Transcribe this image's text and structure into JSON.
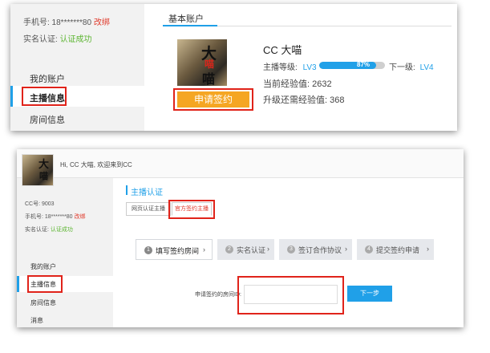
{
  "panel1": {
    "sidebar": {
      "phone_label": "手机号: 18*******80",
      "phone_action": "改绑",
      "verify_label": "实名认证:",
      "verify_status": "认证成功",
      "menu": [
        {
          "label": "我的账户"
        },
        {
          "label": "主播信息",
          "active": true
        },
        {
          "label": "房间信息"
        }
      ]
    },
    "tab_title": "基本账户",
    "avatar_glyphs": [
      "大",
      "喵",
      "喵"
    ],
    "apply_button": "申请签约",
    "name": "CC 大喵",
    "level": {
      "label": "主播等级:",
      "current": "LV3",
      "progress_percent": 87,
      "progress_text": "87%",
      "next_label": "下一级:",
      "next": "LV4"
    },
    "exp_current": "当前经验值: 2632",
    "exp_needed": "升级还需经验值: 368"
  },
  "panel2": {
    "greeting": "Hi, CC 大喵, 欢迎来到CC",
    "avatar_glyphs": [
      "大",
      "喵"
    ],
    "sidebar": {
      "cc_no": "CC号: 9003",
      "phone_label": "手机号: 18*******80",
      "phone_action": "改绑",
      "verify_label": "实名认证:",
      "verify_status": "认证成功",
      "menu": [
        {
          "label": "我的账户"
        },
        {
          "label": "主播信息",
          "active": true
        },
        {
          "label": "房间信息"
        },
        {
          "label": "消息"
        }
      ]
    },
    "section_title": "主播认证",
    "subtabs": [
      {
        "label": "网页认证主播"
      },
      {
        "label": "官方签约主播",
        "active": true
      }
    ],
    "steps": [
      {
        "num": "1",
        "label": "填写签约房间",
        "arrow": "›"
      },
      {
        "num": "2",
        "label": "实名认证",
        "arrow": "›"
      },
      {
        "num": "3",
        "label": "签订合作协议",
        "arrow": "›"
      },
      {
        "num": "4",
        "label": "提交签约申请",
        "arrow": "›"
      }
    ],
    "form": {
      "room_label": "申请签约的房间ID:",
      "room_value": "",
      "next_button": "下一步"
    }
  },
  "colors": {
    "accent_blue": "#20a0e8",
    "apply_orange": "#f5a623",
    "highlight_red": "#e0231a",
    "success_green": "#5cb531"
  }
}
